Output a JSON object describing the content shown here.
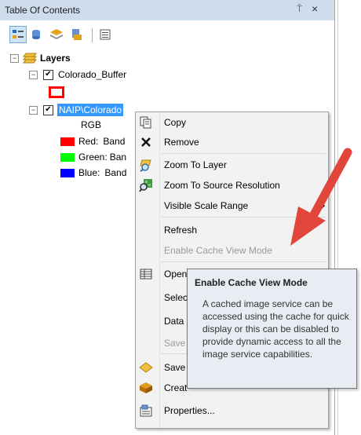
{
  "panel": {
    "title": "Table Of Contents",
    "pin_glyph": "⍑",
    "close_glyph": "×"
  },
  "toolbar": {
    "buttons": [
      "list-by-drawing-order-icon",
      "list-by-source-icon",
      "list-by-visibility-icon",
      "list-by-selection-icon",
      "options-icon"
    ],
    "selected": "list-by-drawing-order-icon"
  },
  "tree": {
    "root": {
      "label": "Layers",
      "expander": "−"
    },
    "layers": [
      {
        "label": "Colorado_Buffer",
        "checked": "✔",
        "expander": "−"
      },
      {
        "label": "NAIP\\Colorado",
        "checked": "✔",
        "expander": "−",
        "renderer": "RGB",
        "bands": [
          {
            "label": "Red:",
            "value": "Band",
            "color": "#ff0000"
          },
          {
            "label": "Green:",
            "value": "Ban",
            "color": "#00ff00"
          },
          {
            "label": "Blue:",
            "value": "Band",
            "color": "#0000ff"
          }
        ]
      }
    ]
  },
  "context_menu": {
    "items": {
      "copy": "Copy",
      "remove": "Remove",
      "zoom_to_layer": "Zoom To Layer",
      "zoom_to_source": "Zoom To Source Resolution",
      "visible_scale": "Visible Scale Range",
      "refresh": "Refresh",
      "enable_cache": "Enable Cache View Mode",
      "open": "Open",
      "select": "Selec",
      "data": "Data",
      "save_as": "Save ",
      "save_layer": "Save ",
      "create": "Creat",
      "properties": "Properties..."
    }
  },
  "tooltip": {
    "title": "Enable Cache View Mode",
    "body": "A cached image service can be accessed using the cache for quick display or this can be disabled to provide dynamic access to all the image service capabilities."
  },
  "annotation": {
    "arrow_color": "#e2453a"
  }
}
